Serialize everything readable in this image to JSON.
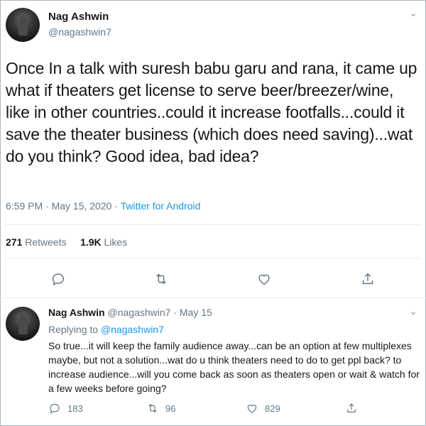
{
  "main_tweet": {
    "author_name": "Nag Ashwin",
    "author_handle": "@nagashwin7",
    "text": "Once In a talk with suresh babu garu and rana, it came up what if theaters get license to serve beer/breezer/wine, like in other countries..could it increase footfalls...could it save the theater business (which does need saving)...wat do you think? Good idea, bad idea?",
    "timestamp": "6:59 PM · May 15, 2020 · ",
    "source": "Twitter for Android",
    "retweets_count": "271",
    "retweets_label": " Retweets",
    "likes_count": "1.9K",
    "likes_label": " Likes",
    "more_icon": "chevron-down-icon",
    "actions": [
      "reply-icon",
      "retweet-icon",
      "like-icon",
      "share-icon"
    ]
  },
  "reply_tweet": {
    "author_name": "Nag Ashwin",
    "author_handle": " @nagashwin7 · May 15",
    "replying_prefix": "Replying to ",
    "replying_to": "@nagashwin7",
    "text": "So true...it will keep the family audience away...can be an option at few multiplexes maybe, but not a solution...wat do u think theaters need to do to get ppl back? to increase audience...will you come back as soon as theaters open or wait & watch for a few weeks before going?",
    "reply_count": "183",
    "retweet_count": "96",
    "like_count": "829"
  },
  "colors": {
    "link": "#1b95e0",
    "secondary_text": "#657786",
    "primary_text": "#14171a",
    "border": "#e6ecf0"
  }
}
